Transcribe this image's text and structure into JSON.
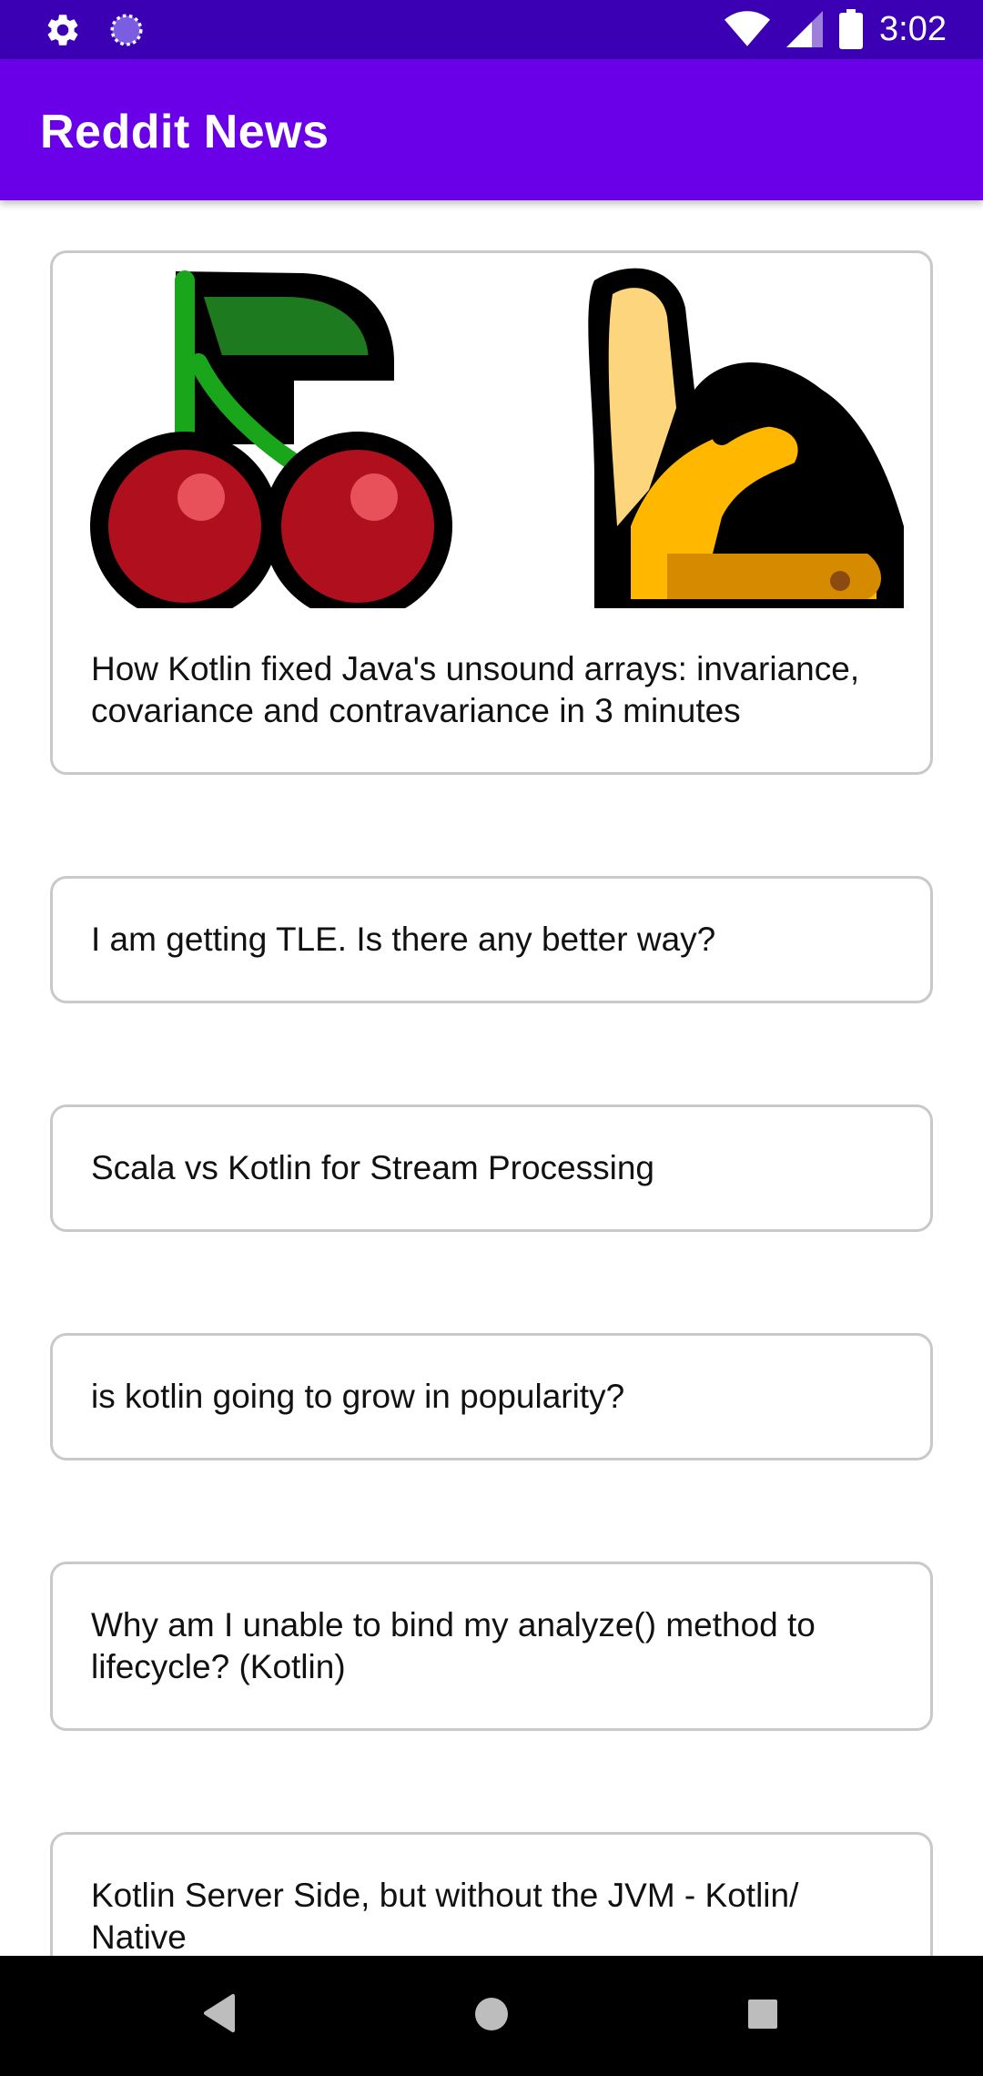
{
  "status_bar": {
    "time": "3:02",
    "icons": [
      "gear-icon",
      "loading-icon",
      "wifi-icon",
      "signal-icon",
      "battery-icon"
    ]
  },
  "app_bar": {
    "title": "Reddit News"
  },
  "posts": [
    {
      "title": "How Kotlin fixed Java's unsound arrays: invariance, covariance and contravariance in 3 minutes",
      "has_image": true,
      "image_icons": [
        "cherries-icon",
        "banana-icon"
      ]
    },
    {
      "title": "I am getting TLE. Is there any better way?",
      "has_image": false
    },
    {
      "title": "Scala vs Kotlin for Stream Processing",
      "has_image": false
    },
    {
      "title": "is kotlin going to grow in popularity?",
      "has_image": false
    },
    {
      "title": "Why am I unable to bind my analyze() method to lifecycle? (Kotlin)",
      "has_image": false
    },
    {
      "title": "Kotlin Server Side, but without the JVM - Kotlin/ Native",
      "has_image": false
    }
  ],
  "nav_bar": {
    "buttons": [
      "back-icon",
      "home-icon",
      "recents-icon"
    ]
  },
  "colors": {
    "status_bar": "#3b00b3",
    "app_bar": "#6a00e8",
    "card_border": "#c9c9c9"
  }
}
